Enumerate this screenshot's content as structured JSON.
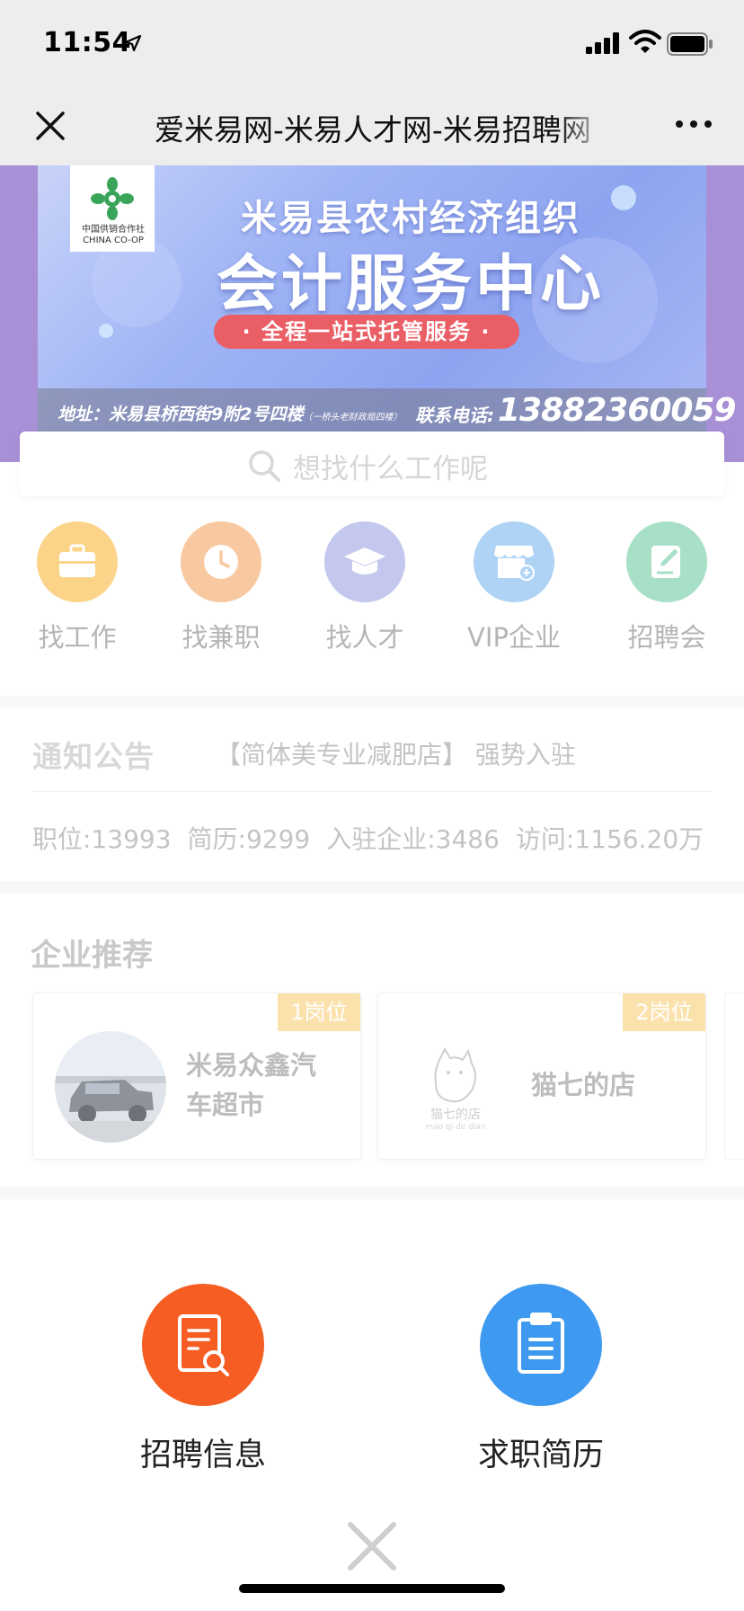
{
  "status_bar": {
    "time": "11:54"
  },
  "nav": {
    "title": "爱米易网-米易人才网-米易招聘网"
  },
  "banner": {
    "logo_label": "中国供销合作社 CHINA CO-OP",
    "line1": "米易县农村经济组织",
    "line2": "会计服务中心",
    "pill": "· 全程一站式托管服务 ·",
    "address": "地址：米易县桥西街9附2号四楼",
    "address_note": "（一桥头老财政局四楼）",
    "phone_label": "联系电话:",
    "phone": "13882360059"
  },
  "search": {
    "placeholder": "想找什么工作呢"
  },
  "categories": [
    {
      "label": "找工作",
      "color": "#fbd48a",
      "icon": "briefcase-icon"
    },
    {
      "label": "找兼职",
      "color": "#f8c9a0",
      "icon": "clock-icon"
    },
    {
      "label": "找人才",
      "color": "#c4c8ee",
      "icon": "graduation-cap-icon"
    },
    {
      "label": "VIP企业",
      "color": "#aed3f5",
      "icon": "shop-icon"
    },
    {
      "label": "招聘会",
      "color": "#a8e0c7",
      "icon": "note-edit-icon"
    }
  ],
  "notice": {
    "logo": "通知公告",
    "text": "【简体美专业减肥店】 强势入驻"
  },
  "stats": [
    "职位:13993",
    "简历:9299",
    "入驻企业:3486",
    "访问:1156.20万"
  ],
  "recommend": {
    "title": "企业推荐",
    "cards": [
      {
        "name": "米易众鑫汽车超市",
        "badge": "1岗位"
      },
      {
        "name": "猫七的店",
        "badge": "2岗位",
        "logo_text": "猫七的店",
        "logo_pinyin": "mao qi de dian"
      }
    ]
  },
  "actions": [
    {
      "label": "招聘信息",
      "color": "#f65d22",
      "icon": "document-search-icon"
    },
    {
      "label": "求职简历",
      "color": "#3e9af0",
      "icon": "clipboard-icon"
    }
  ]
}
